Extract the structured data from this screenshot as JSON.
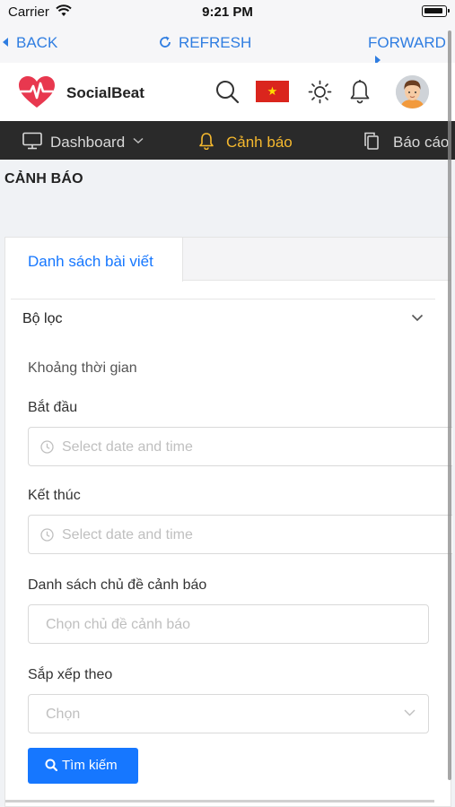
{
  "status_bar": {
    "carrier": "Carrier",
    "time": "9:21 PM"
  },
  "browser_nav": {
    "back": "BACK",
    "refresh": "REFRESH",
    "forward": "FORWARD"
  },
  "header": {
    "brand": "SocialBeat",
    "flag_star": "★"
  },
  "top_nav": {
    "dashboard": "Dashboard",
    "alert": "Cảnh báo",
    "report": "Báo cáo"
  },
  "page": {
    "title": "CẢNH BÁO"
  },
  "tabs": [
    {
      "label": "Danh sách bài viết",
      "active": true
    }
  ],
  "filter": {
    "title": "Bộ lọc",
    "time_range_label": "Khoảng thời gian",
    "start_label": "Bắt đầu",
    "start_placeholder": "Select date and time",
    "end_label": "Kết thúc",
    "end_placeholder": "Select date and time",
    "topics_label": "Danh sách chủ đề cảnh báo",
    "topics_placeholder": "Chọn chủ đề cảnh báo",
    "sort_label": "Sắp xếp theo",
    "sort_placeholder": "Chọn",
    "search_button": "Tìm kiếm"
  },
  "colors": {
    "accent": "#1677ff",
    "nav_active": "#f5b82e",
    "nav_bg": "#2a2a2a",
    "browser_link": "#2f7de1",
    "brand_heart": "#e8384f"
  },
  "icons": [
    "wifi-icon",
    "back-arrow-icon",
    "refresh-icon",
    "forward-arrow-icon",
    "heart-pulse-logo-icon",
    "search-icon",
    "vietnam-flag-icon",
    "sun-icon",
    "bell-icon",
    "avatar",
    "monitor-icon",
    "chevron-down-icon",
    "file-copy-icon",
    "clock-icon"
  ]
}
